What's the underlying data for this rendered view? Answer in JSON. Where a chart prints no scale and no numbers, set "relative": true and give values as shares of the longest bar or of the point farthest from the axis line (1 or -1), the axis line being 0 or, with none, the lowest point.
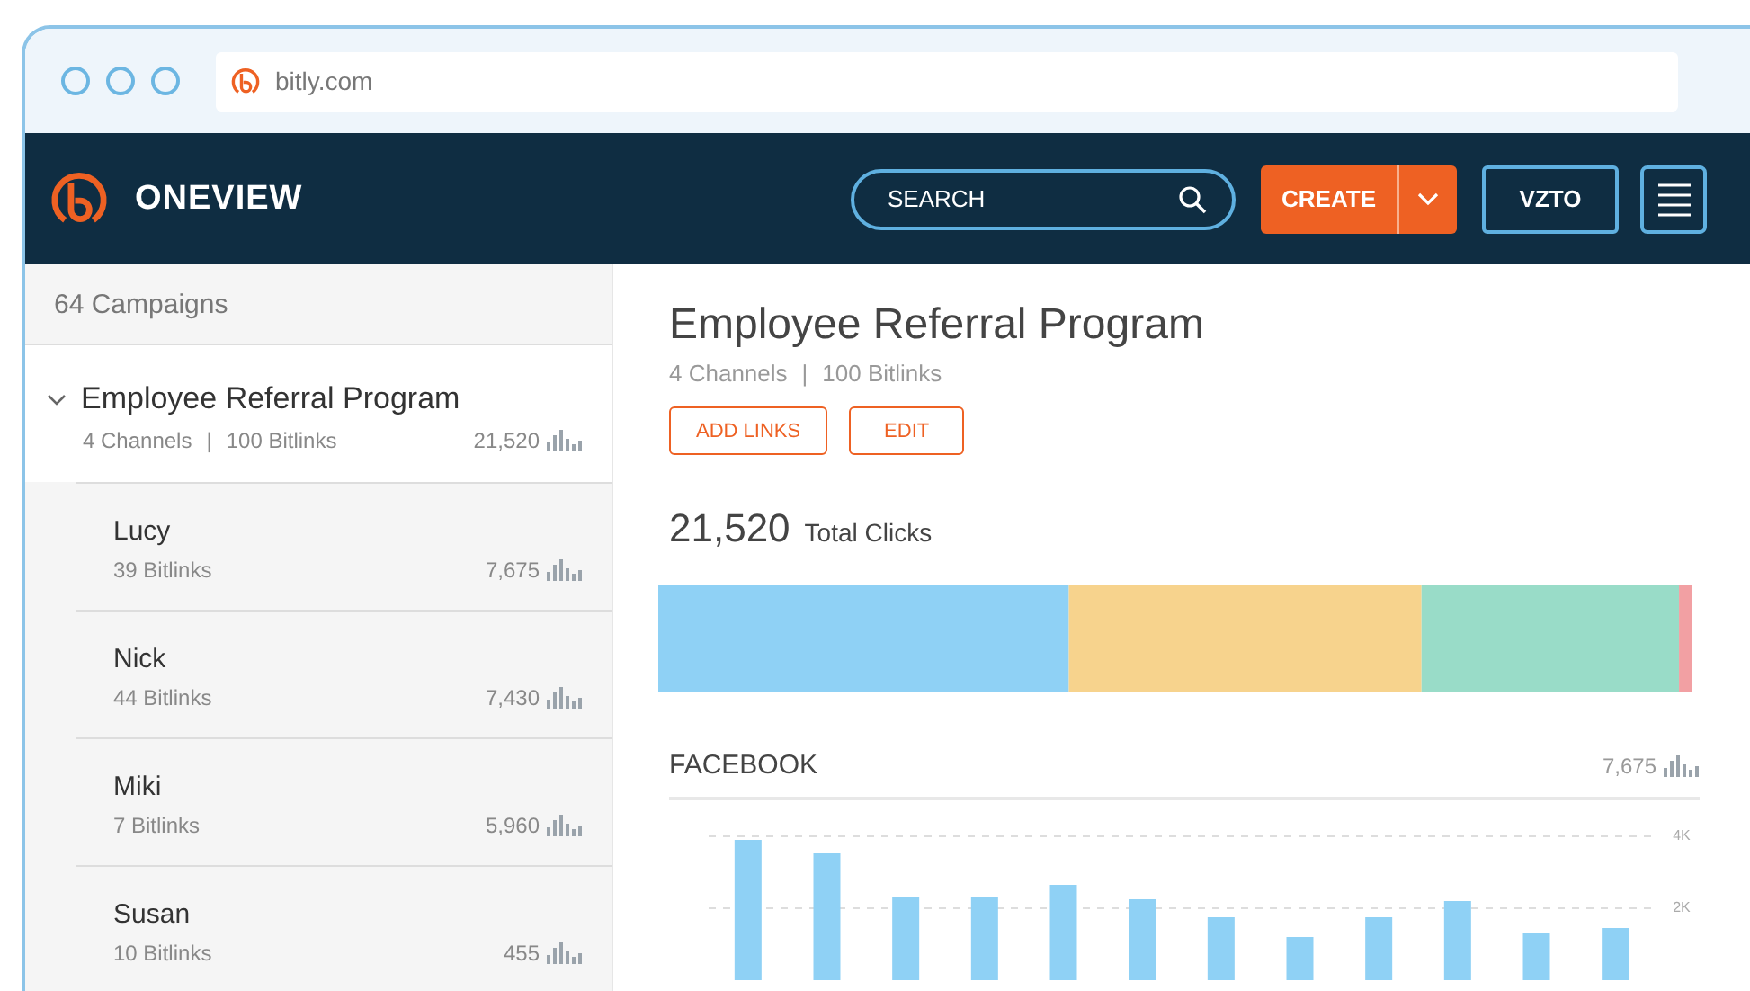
{
  "browser": {
    "url": "bitly.com"
  },
  "header": {
    "brand": "ONEVIEW",
    "search": {
      "placeholder": "SEARCH"
    },
    "create_button": "CREATE",
    "user_button": "VZTO"
  },
  "sidebar": {
    "count_label": "64 Campaigns",
    "campaigns": [
      {
        "name": "Employee Referral Program",
        "expanded": true,
        "channels": "4 Channels",
        "separator": "|",
        "bitlinks": "100 Bitlinks",
        "clicks": "21,520",
        "children": [
          {
            "name": "Lucy",
            "bitlinks": "39 Bitlinks",
            "clicks": "7,675"
          },
          {
            "name": "Nick",
            "bitlinks": "44 Bitlinks",
            "clicks": "7,430"
          },
          {
            "name": "Miki",
            "bitlinks": "7 Bitlinks",
            "clicks": "5,960"
          },
          {
            "name": "Susan",
            "bitlinks": "10 Bitlinks",
            "clicks": "455"
          }
        ]
      }
    ]
  },
  "detail": {
    "title": "Employee Referral Program",
    "channels": "4 Channels",
    "separator": "|",
    "bitlinks": "100 Bitlinks",
    "buttons": [
      "ADD LINKS",
      "EDIT"
    ],
    "total": "21,520",
    "total_label": "Total Clicks",
    "breakdown": {
      "chart_data": {
        "type": "bar",
        "orientation": "horizontal",
        "stacked": true,
        "relative": true,
        "series": [
          {
            "color": "#8fd1f5",
            "values": [
              0.397
            ]
          },
          {
            "color": "#f7d38d",
            "values": [
              0.341
            ]
          },
          {
            "color": "#99dcc8",
            "values": [
              0.249
            ]
          },
          {
            "color": "#f2a0a3",
            "values": [
              0.013
            ]
          }
        ]
      }
    },
    "channel": {
      "name": "FACEBOOK",
      "clicks": "7,675",
      "chart_data": {
        "type": "bar",
        "values": [
          3900,
          3550,
          2300,
          2300,
          2650,
          2250,
          1750,
          1200,
          1750,
          2200,
          1300,
          1450
        ],
        "ylim": [
          0,
          4000
        ],
        "yticks": [
          {
            "value": 2000,
            "label": "2K"
          },
          {
            "value": 4000,
            "label": "4K"
          }
        ]
      }
    }
  }
}
